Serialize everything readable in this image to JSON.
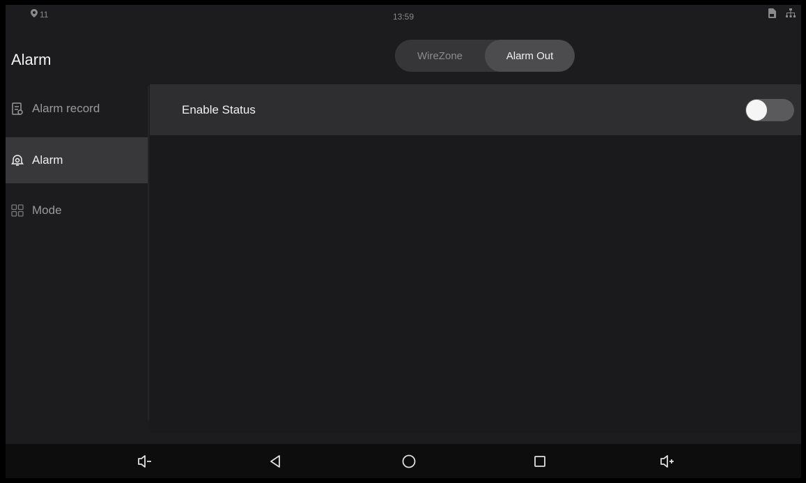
{
  "status_bar": {
    "left_text": "11",
    "time": "13:59",
    "icons": [
      "location-icon",
      "sd-card-icon",
      "network-icon"
    ]
  },
  "header": {
    "title": "Alarm",
    "tabs": [
      {
        "label": "WireZone",
        "active": false
      },
      {
        "label": "Alarm Out",
        "active": true
      }
    ]
  },
  "sidebar": {
    "items": [
      {
        "label": "Alarm record",
        "icon": "alarm-record-icon",
        "active": false
      },
      {
        "label": "Alarm",
        "icon": "alarm-icon",
        "active": true
      },
      {
        "label": "Mode",
        "icon": "mode-grid-icon",
        "active": false
      }
    ]
  },
  "content": {
    "enable_status": {
      "label": "Enable Status",
      "enabled": false
    }
  },
  "navbar": {
    "icons": [
      "volume-down-icon",
      "back-icon",
      "home-icon",
      "recents-icon",
      "volume-up-icon"
    ]
  },
  "colors": {
    "background": "#1c1c1e",
    "row_background": "#2e2e30",
    "active_item": "#38383a",
    "toggle_track": "#5a5a5c",
    "toggle_knob": "#f5f5f5"
  }
}
